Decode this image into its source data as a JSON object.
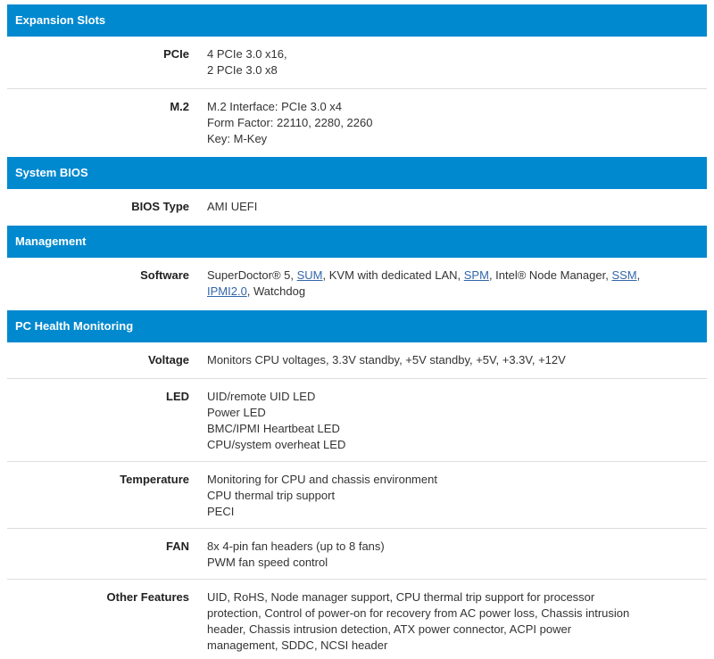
{
  "sections": [
    {
      "title": "Expansion Slots",
      "rows": [
        {
          "label": "PCIe",
          "lines": [
            "4 PCIe 3.0 x16,",
            "2 PCIe 3.0 x8"
          ]
        },
        {
          "label": "M.2",
          "lines": [
            "M.2 Interface: PCIe 3.0 x4",
            "Form Factor: 22110, 2280, 2260",
            "Key: M-Key"
          ]
        }
      ]
    },
    {
      "title": "System BIOS",
      "rows": [
        {
          "label": "BIOS Type",
          "lines": [
            "AMI UEFI"
          ]
        }
      ]
    },
    {
      "title": "Management",
      "software": {
        "label": "Software",
        "t1": "SuperDoctor® 5, ",
        "link_sum": "SUM",
        "t2": ", KVM with dedicated LAN, ",
        "link_spm": "SPM",
        "t3": ", Intel® Node Manager, ",
        "link_ssm": "SSM",
        "t4": ",",
        "link_ipmi": "IPMI2.0",
        "t5": ", Watchdog"
      }
    },
    {
      "title": "PC Health Monitoring",
      "rows": [
        {
          "label": "Voltage",
          "lines": [
            "Monitors CPU voltages, 3.3V standby, +5V standby, +5V, +3.3V, +12V"
          ]
        },
        {
          "label": "LED",
          "lines": [
            "UID/remote UID LED",
            "Power LED",
            "BMC/IPMI Heartbeat LED",
            "CPU/system overheat LED"
          ]
        },
        {
          "label": "Temperature",
          "lines": [
            "Monitoring for CPU and chassis environment",
            "CPU thermal trip support",
            "PECI"
          ]
        },
        {
          "label": "FAN",
          "lines": [
            "8x 4-pin fan headers (up to 8 fans)",
            "PWM fan speed control"
          ]
        },
        {
          "label": "Other Features",
          "lines": [
            "UID, RoHS, Node manager support, CPU thermal trip support for processor",
            "protection, Control of power-on for recovery from AC power loss, Chassis intrusion",
            "header, Chassis intrusion detection, ATX power connector, ACPI power",
            "management, SDDC, NCSI header"
          ]
        }
      ]
    }
  ]
}
